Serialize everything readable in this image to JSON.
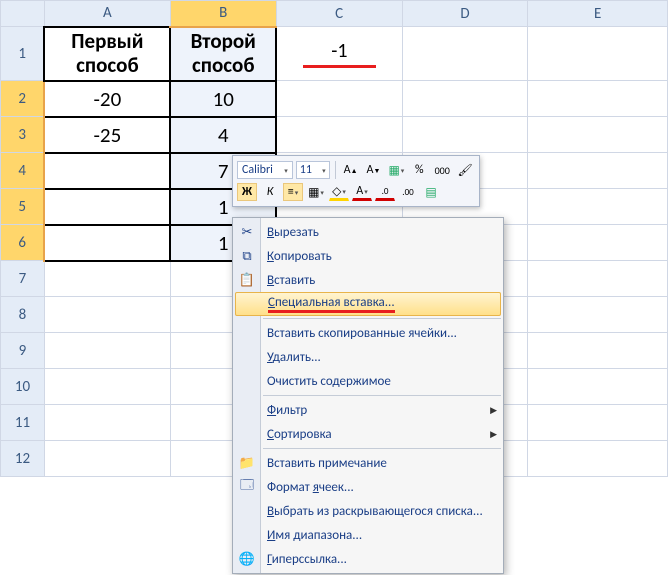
{
  "columns": [
    "A",
    "B",
    "C",
    "D",
    "E"
  ],
  "rows": [
    "1",
    "2",
    "3",
    "4",
    "5",
    "6",
    "7",
    "8",
    "9",
    "10",
    "11",
    "12"
  ],
  "headers": {
    "A": "Первый способ",
    "B": "Второй способ"
  },
  "cells": {
    "A2": "-20",
    "A3": "-25",
    "B2": "10",
    "B3": "4",
    "B4": "7",
    "B5": "1",
    "B6": "1",
    "C1": "-1"
  },
  "selected_column": "B",
  "minitoolbar": {
    "font": "Calibri",
    "size": "11",
    "buttons_row1": [
      "grow-font",
      "shrink-font",
      "styles",
      "percent",
      "thousands",
      "paint"
    ],
    "bold": "Ж",
    "italic": "К",
    "buttons_row2": [
      "center",
      "borders",
      "fill-color",
      "font-color",
      "decrease-decimal",
      "increase-decimal",
      "merge"
    ]
  },
  "context_menu": [
    {
      "id": "cut",
      "label": "Вырезать",
      "u": 0,
      "icon": "scissors"
    },
    {
      "id": "copy",
      "label": "Копировать",
      "u": 0,
      "icon": "copy"
    },
    {
      "id": "paste",
      "label": "Вставить",
      "u": 0,
      "icon": "paste"
    },
    {
      "id": "paste-special",
      "label": "Специальная вставка...",
      "u": 0,
      "highlight": true
    },
    {
      "sep": true
    },
    {
      "id": "insert-copied",
      "label": "Вставить скопированные ячейки..."
    },
    {
      "id": "delete",
      "label": "Удалить...",
      "u": 0
    },
    {
      "id": "clear",
      "label": "Очистить содержимое"
    },
    {
      "sep": true
    },
    {
      "id": "filter",
      "label": "Фильтр",
      "u": 0,
      "sub": true
    },
    {
      "id": "sort",
      "label": "Сортировка",
      "u": 0,
      "sub": true
    },
    {
      "sep": true
    },
    {
      "id": "insert-comment",
      "label": "Вставить примечание",
      "icon": "folder"
    },
    {
      "id": "format-cells",
      "label": "Формат ячеек...",
      "u": 7,
      "icon": "format"
    },
    {
      "id": "pick-list",
      "label": "Выбрать из раскрывающегося списка...",
      "u": 0
    },
    {
      "id": "name-range",
      "label": "Имя диапазона...",
      "u": 0
    },
    {
      "id": "hyperlink",
      "label": "Гиперссылка...",
      "u": 0,
      "icon": "globe"
    }
  ],
  "chart_data": {
    "type": "table",
    "columns": [
      "Первый способ",
      "Второй способ"
    ],
    "rows": [
      [
        -20,
        10
      ],
      [
        -25,
        4
      ],
      [
        null,
        7
      ],
      [
        null,
        1
      ],
      [
        null,
        1
      ]
    ],
    "extra_cells": {
      "C1": -1
    }
  }
}
